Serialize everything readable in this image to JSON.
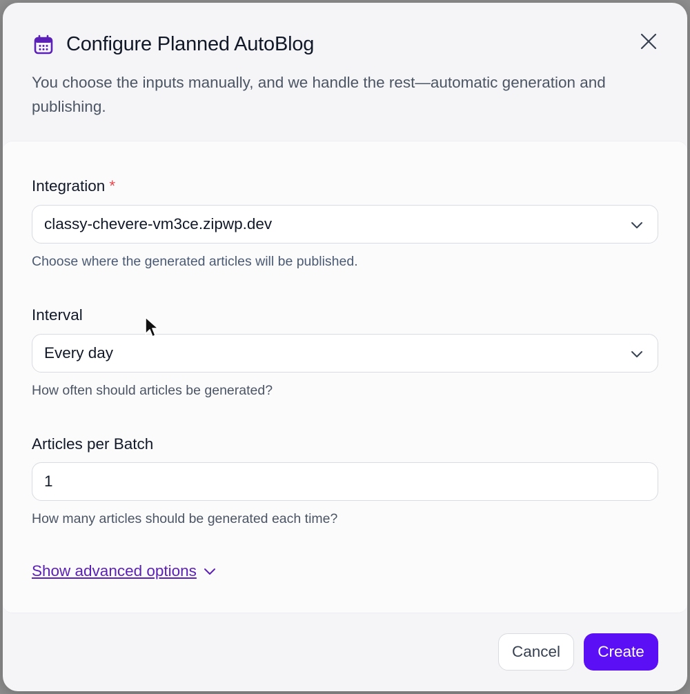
{
  "dialog": {
    "title": "Configure Planned AutoBlog",
    "subtitle": "You choose the inputs manually, and we handle the rest—automatic generation and publishing.",
    "title_icon": "calendar-icon",
    "close_icon": "close-icon"
  },
  "form": {
    "integration": {
      "label": "Integration",
      "required_mark": "*",
      "value": "classy-chevere-vm3ce.zipwp.dev",
      "help": "Choose where the generated articles will be published."
    },
    "interval": {
      "label": "Interval",
      "value": "Every day",
      "help": "How often should articles be generated?"
    },
    "articles_per_batch": {
      "label": "Articles per Batch",
      "value": "1",
      "help": "How many articles should be generated each time?"
    },
    "advanced_link": "Show advanced options"
  },
  "footer": {
    "cancel_label": "Cancel",
    "create_label": "Create"
  },
  "colors": {
    "accent": "#5b0ff5",
    "link": "#5b21b6",
    "required": "#e5484d",
    "icon": "#5b21b6"
  }
}
